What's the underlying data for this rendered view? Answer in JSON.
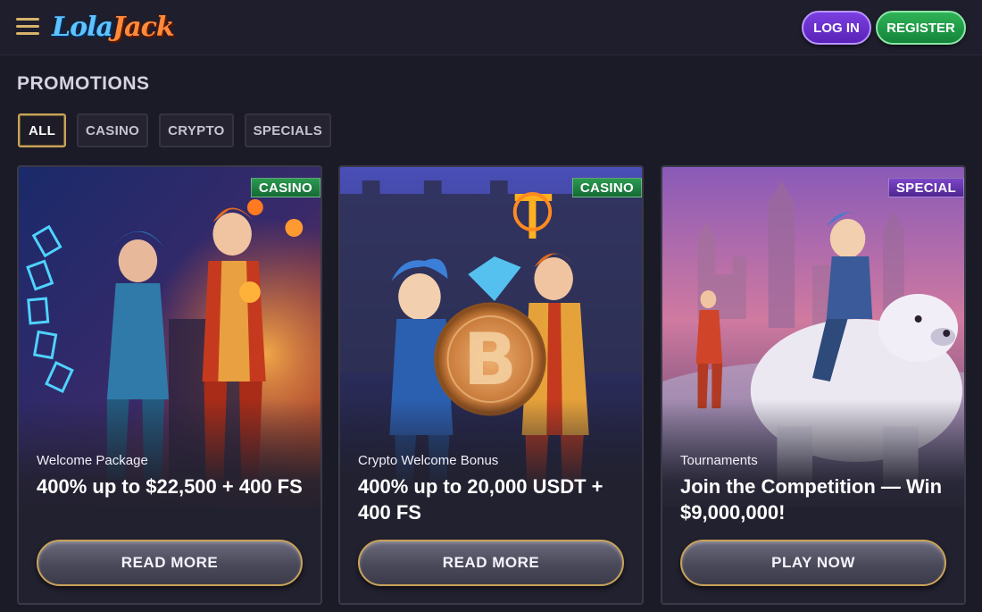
{
  "header": {
    "menu_icon": "hamburger-menu-icon",
    "logo_text_left": "Lola",
    "logo_text_right": "Jack",
    "login_label": "LOG IN",
    "register_label": "REGISTER"
  },
  "page": {
    "title": "PROMOTIONS"
  },
  "filters": [
    {
      "label": "ALL",
      "active": true
    },
    {
      "label": "CASINO",
      "active": false
    },
    {
      "label": "CRYPTO",
      "active": false
    },
    {
      "label": "SPECIALS",
      "active": false
    }
  ],
  "cards": [
    {
      "tag": "CASINO",
      "subtitle": "Welcome Package",
      "headline": "400% up to $22,500 + 400 FS",
      "button": "READ MORE"
    },
    {
      "tag": "CASINO",
      "subtitle": "Crypto Welcome Bonus",
      "headline": "400% up to 20,000 USDT + 400 FS",
      "button": "READ MORE"
    },
    {
      "tag": "SPECIAL",
      "subtitle": "Tournaments",
      "headline": "Join the Competition — Win $9,000,000!",
      "button": "PLAY NOW"
    }
  ],
  "colors": {
    "background": "#1b1a27",
    "accent_gold": "#c9a35a",
    "login_purple": "#6a31cc",
    "register_green": "#22a04a",
    "tag_casino": "#1f8a45",
    "tag_special": "#6535ad"
  }
}
